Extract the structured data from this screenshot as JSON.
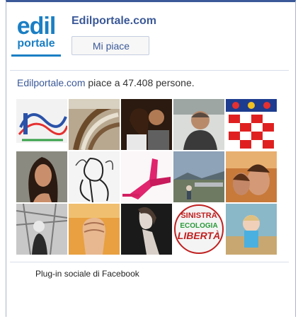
{
  "page": {
    "name": "Edilportale.com",
    "like_label": "Mi piace",
    "logo_top": "edil",
    "logo_bottom": "portale"
  },
  "fans": {
    "link_text": "Edilportale.com",
    "rest_text": " piace a 47.408 persone."
  },
  "footer": {
    "text": "Plug-in sociale di Facebook"
  },
  "colors": {
    "facebook_blue": "#3b5998",
    "brand_blue": "#1b7fc4"
  }
}
